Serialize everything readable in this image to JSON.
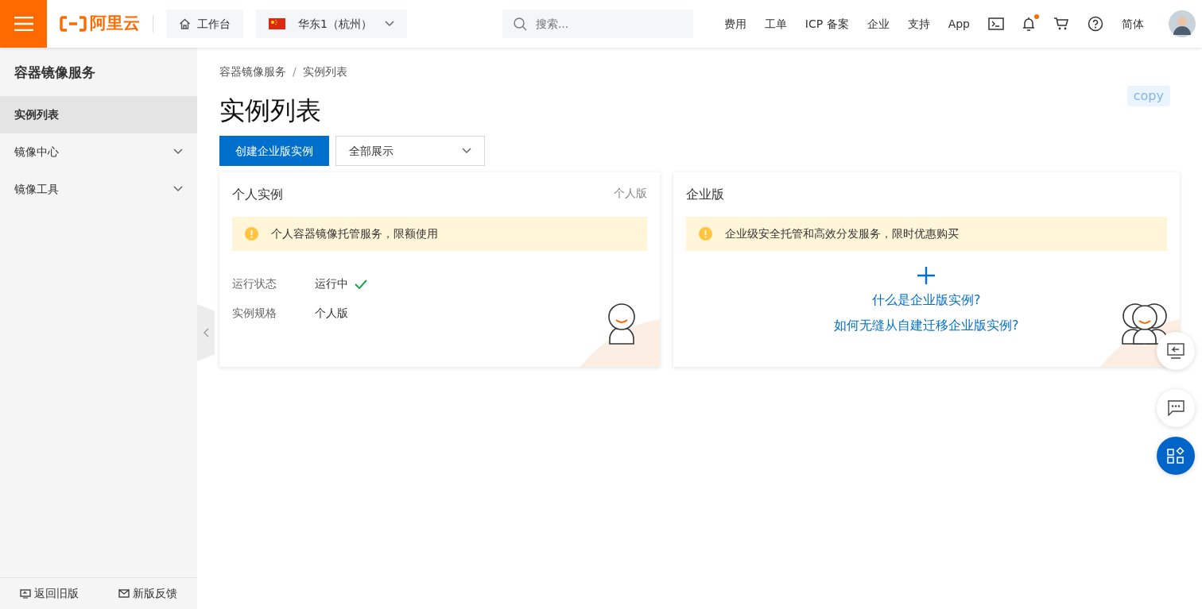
{
  "topbar": {
    "logo_text": "阿里云",
    "workbench": "工作台",
    "region": "华东1（杭州）",
    "search": {
      "placeholder": "搜索..."
    },
    "links": [
      "费用",
      "工单",
      "ICP 备案",
      "企业",
      "支持",
      "App"
    ],
    "notification_dot": true,
    "language": "简体"
  },
  "sidebar": {
    "title": "容器镜像服务",
    "items": [
      {
        "label": "实例列表",
        "selected": true,
        "kind": "link"
      },
      {
        "label": "镜像中心",
        "selected": false,
        "kind": "group",
        "expanded": false
      },
      {
        "label": "镜像工具",
        "selected": false,
        "kind": "group",
        "expanded": false
      }
    ],
    "footer": [
      "返回旧版",
      "新版反馈"
    ]
  },
  "breadcrumb": [
    "容器镜像服务",
    "实例列表"
  ],
  "breadcrumb_separator": "/",
  "page_title": "实例列表",
  "create_button": "创建企业版实例",
  "filter_select": "全部展示",
  "copy_button": "copy",
  "cards": [
    {
      "kind": "personal",
      "title": "个人实例",
      "tag": "个人版",
      "alert": "个人容器镜像托管服务，限额使用",
      "fields": [
        {
          "label": "运行状态",
          "value": "运行中",
          "ok": true
        },
        {
          "label": "实例规格",
          "value": "个人版",
          "ok": false
        }
      ]
    },
    {
      "kind": "enterprise",
      "title": "企业版",
      "alert": "企业级安全托管和高效分发服务，限时优惠购买",
      "links": [
        "什么是企业版实例?",
        "如何无缝从自建迁移企业版实例?"
      ]
    }
  ]
}
